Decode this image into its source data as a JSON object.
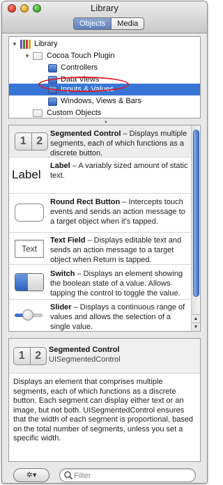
{
  "window": {
    "title": "Library"
  },
  "scope_tabs": {
    "objects": "Objects",
    "media": "Media"
  },
  "tree": {
    "items": [
      {
        "label": "Library"
      },
      {
        "label": "Cocoa Touch Plugin"
      },
      {
        "label": "Controllers"
      },
      {
        "label": "Data Views"
      },
      {
        "label": "Inputs & Values",
        "selected": true
      },
      {
        "label": "Windows, Views & Bars"
      },
      {
        "label": "Custom Objects"
      }
    ]
  },
  "objects": [
    {
      "icon": "segmented-control-icon",
      "icon_text": [
        "1",
        "2"
      ],
      "name": "Segmented Control",
      "desc": " – Displays multiple segments, each of which functions as a discrete button."
    },
    {
      "icon": "label-icon",
      "icon_text": "Label",
      "name": "Label",
      "desc": " – A variably sized amount of static text."
    },
    {
      "icon": "round-rect-button-icon",
      "name": "Round Rect Button",
      "desc": " – Intercepts touch events and sends an action message to a target object when it's tapped."
    },
    {
      "icon": "text-field-icon",
      "icon_text": "Text",
      "name": "Text Field",
      "desc": " – Displays editable text and sends an action message to a target object when Return is tapped."
    },
    {
      "icon": "switch-icon",
      "name": "Switch",
      "desc": " – Displays an element showing the boolean state of a value. Allows tapping the control to toggle the value."
    },
    {
      "icon": "slider-icon",
      "name": "Slider",
      "desc": " – Displays a continuous range of values and allows the selection of a single value."
    }
  ],
  "detail": {
    "title": "Segmented Control",
    "class_name": "UISegmentedControl",
    "description": "Displays an element that comprises multiple segments, each of which functions as a discrete button. Each segment can display either text or an image, but not both. UISegmentedControl ensures that the width of each segment is proportional, based on the total number of segments, unless you set a specific width."
  },
  "bottom": {
    "gear_label": "✲▾",
    "filter_placeholder": "Filter"
  },
  "colors": {
    "selection": "#3875d7",
    "annotation_oval": "#e0161e"
  }
}
